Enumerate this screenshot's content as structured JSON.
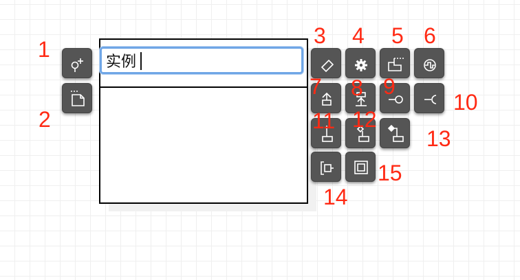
{
  "editor": {
    "class_name_value": "实例"
  },
  "labels": [
    "1",
    "2",
    "3",
    "4",
    "5",
    "6",
    "7",
    "8",
    "9",
    "10",
    "11",
    "12",
    "13",
    "14",
    "15"
  ],
  "buttons": [
    {
      "id": 1,
      "icon": "add-attribute-icon"
    },
    {
      "id": 2,
      "icon": "add-note-icon"
    },
    {
      "id": 3,
      "icon": "diamond-shape-icon"
    },
    {
      "id": 4,
      "icon": "gear-icon"
    },
    {
      "id": 5,
      "icon": "package-folder-icon"
    },
    {
      "id": 6,
      "icon": "signal-circle-icon"
    },
    {
      "id": 7,
      "icon": "generalization-up-icon"
    },
    {
      "id": 8,
      "icon": "interface-realization-icon"
    },
    {
      "id": 9,
      "icon": "provided-interface-icon"
    },
    {
      "id": 10,
      "icon": "required-interface-icon"
    },
    {
      "id": 11,
      "icon": "association-icon"
    },
    {
      "id": 12,
      "icon": "aggregation-icon"
    },
    {
      "id": 13,
      "icon": "composition-icon"
    },
    {
      "id": 14,
      "icon": "dependency-bracket-icon"
    },
    {
      "id": 15,
      "icon": "frame-square-icon"
    }
  ],
  "colors": {
    "accent": "#6fa6e6",
    "toolbar": "#555555",
    "label": "#ff2a14"
  }
}
